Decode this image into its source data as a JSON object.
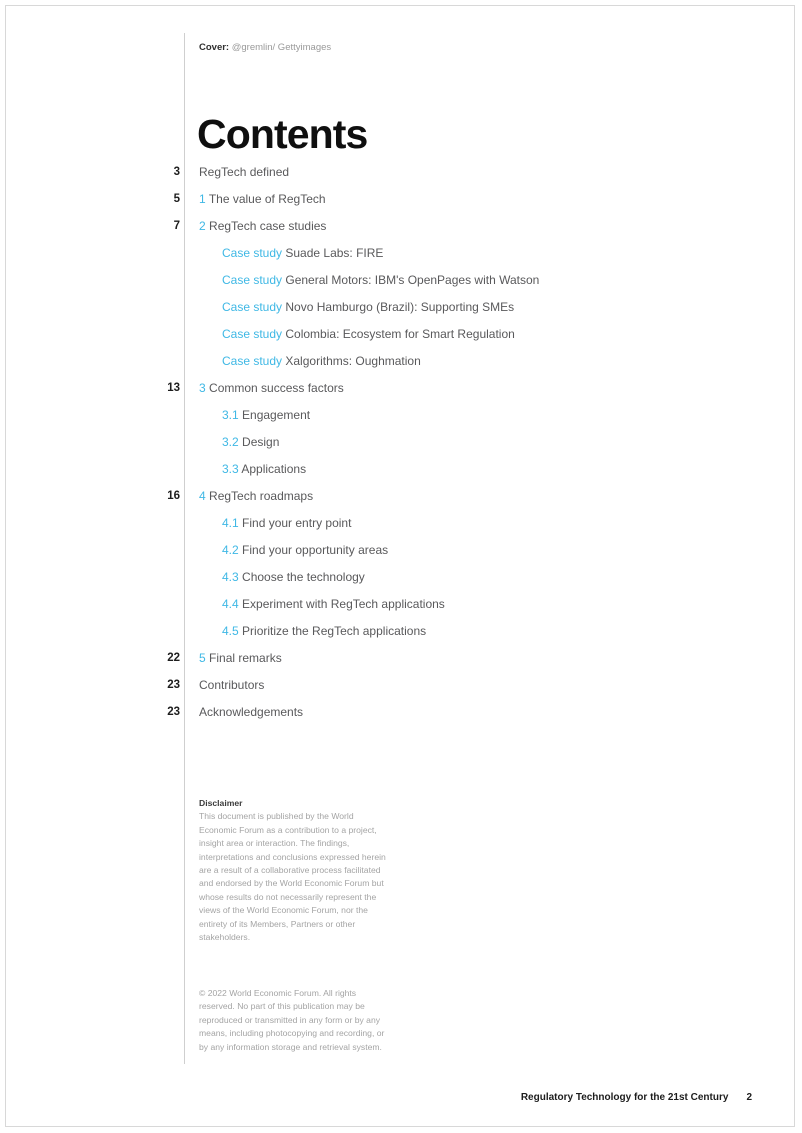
{
  "document": {
    "title": "Contents",
    "cover_credit_label": "Cover:",
    "cover_credit_value": "@gremlin/ Gettyimages",
    "accent_color": "#3fb8e5",
    "text_color": "#59595b",
    "muted_color": "#a4a4a4",
    "rule_color": "#cfcfcf"
  },
  "toc": {
    "entries": [
      {
        "page": "3",
        "num": "",
        "tag": "",
        "text": "RegTech defined",
        "level": 0
      },
      {
        "page": "5",
        "num": "1",
        "tag": "",
        "text": "The value of RegTech",
        "level": 0
      },
      {
        "page": "7",
        "num": "2",
        "tag": "",
        "text": "RegTech case studies",
        "level": 0
      },
      {
        "page": "",
        "num": "",
        "tag": "Case study",
        "text": "Suade Labs: FIRE",
        "level": 1
      },
      {
        "page": "",
        "num": "",
        "tag": "Case study",
        "text": "General Motors: IBM's OpenPages with Watson",
        "level": 1
      },
      {
        "page": "",
        "num": "",
        "tag": "Case study",
        "text": "Novo Hamburgo (Brazil): Supporting SMEs",
        "level": 1
      },
      {
        "page": "",
        "num": "",
        "tag": "Case study",
        "text": "Colombia: Ecosystem for Smart Regulation",
        "level": 1
      },
      {
        "page": "",
        "num": "",
        "tag": "Case study",
        "text": "Xalgorithms: Oughmation",
        "level": 1
      },
      {
        "page": "13",
        "num": "3",
        "tag": "",
        "text": "Common success factors",
        "level": 0
      },
      {
        "page": "",
        "num": "3.1",
        "tag": "",
        "text": "Engagement",
        "level": 1
      },
      {
        "page": "",
        "num": "3.2",
        "tag": "",
        "text": "Design",
        "level": 1
      },
      {
        "page": "",
        "num": "3.3",
        "tag": "",
        "text": "Applications",
        "level": 1
      },
      {
        "page": "16",
        "num": "4",
        "tag": "",
        "text": "RegTech roadmaps",
        "level": 0
      },
      {
        "page": "",
        "num": "4.1",
        "tag": "",
        "text": "Find your entry point",
        "level": 1
      },
      {
        "page": "",
        "num": "4.2",
        "tag": "",
        "text": "Find your opportunity areas",
        "level": 1
      },
      {
        "page": "",
        "num": "4.3",
        "tag": "",
        "text": "Choose the technology",
        "level": 1
      },
      {
        "page": "",
        "num": "4.4",
        "tag": "",
        "text": "Experiment with RegTech applications",
        "level": 1
      },
      {
        "page": "",
        "num": "4.5",
        "tag": "",
        "text": "Prioritize the RegTech applications",
        "level": 1
      },
      {
        "page": "22",
        "num": "5",
        "tag": "",
        "text": "Final remarks",
        "level": 0
      },
      {
        "page": "23",
        "num": "",
        "tag": "",
        "text": "Contributors",
        "level": 0
      },
      {
        "page": "23",
        "num": "",
        "tag": "",
        "text": "Acknowledgements",
        "level": 0
      }
    ]
  },
  "disclaimer": {
    "heading": "Disclaimer",
    "body": "This document is published by the World Economic Forum as a contribution to a project, insight area or interaction. The findings, interpretations and conclusions expressed herein are a result of a collaborative process facilitated and endorsed by the World Economic Forum but whose results do not necessarily represent the views of the World Economic Forum, nor the entirety of its Members, Partners or other stakeholders."
  },
  "copyright": {
    "text": "© 2022 World Economic Forum. All rights reserved. No part of this publication may be reproduced or transmitted in any form or by any means, including photocopying and recording, or by any information storage and retrieval system."
  },
  "footer": {
    "title": "Regulatory Technology for the 21st Century",
    "page_number": "2"
  }
}
